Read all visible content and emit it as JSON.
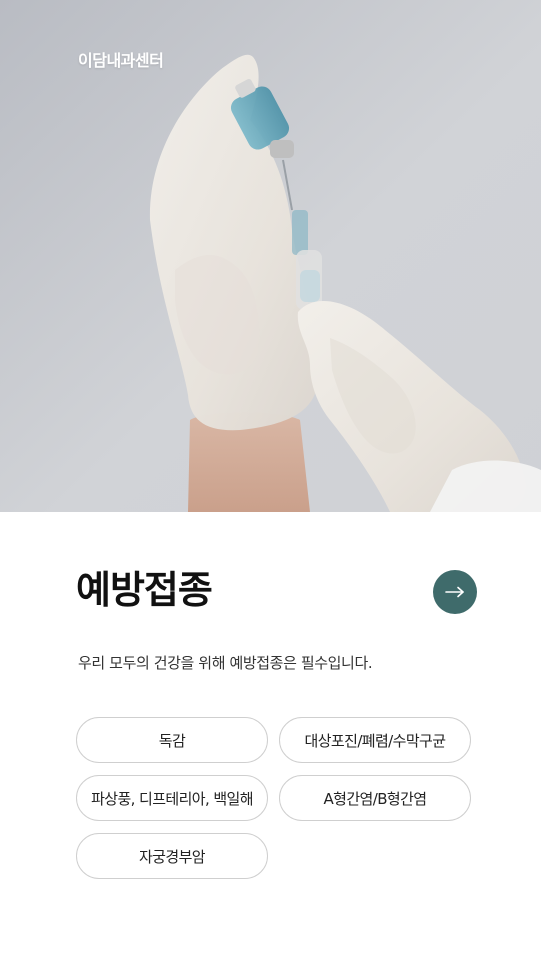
{
  "brand": {
    "name": "이담내과센터"
  },
  "section": {
    "title": "예방접종",
    "description": "우리 모두의 건강을 위해 예방접종은 필수입니다.",
    "arrow_icon": "arrow-right-icon",
    "accent_color": "#3f6b6b"
  },
  "tags": [
    {
      "label": "독감"
    },
    {
      "label": "대상포진/폐렴/수막구균"
    },
    {
      "label": "파상풍, 디프테리아, 백일해"
    },
    {
      "label": "A형간염/B형간염"
    },
    {
      "label": "자궁경부암"
    }
  ]
}
